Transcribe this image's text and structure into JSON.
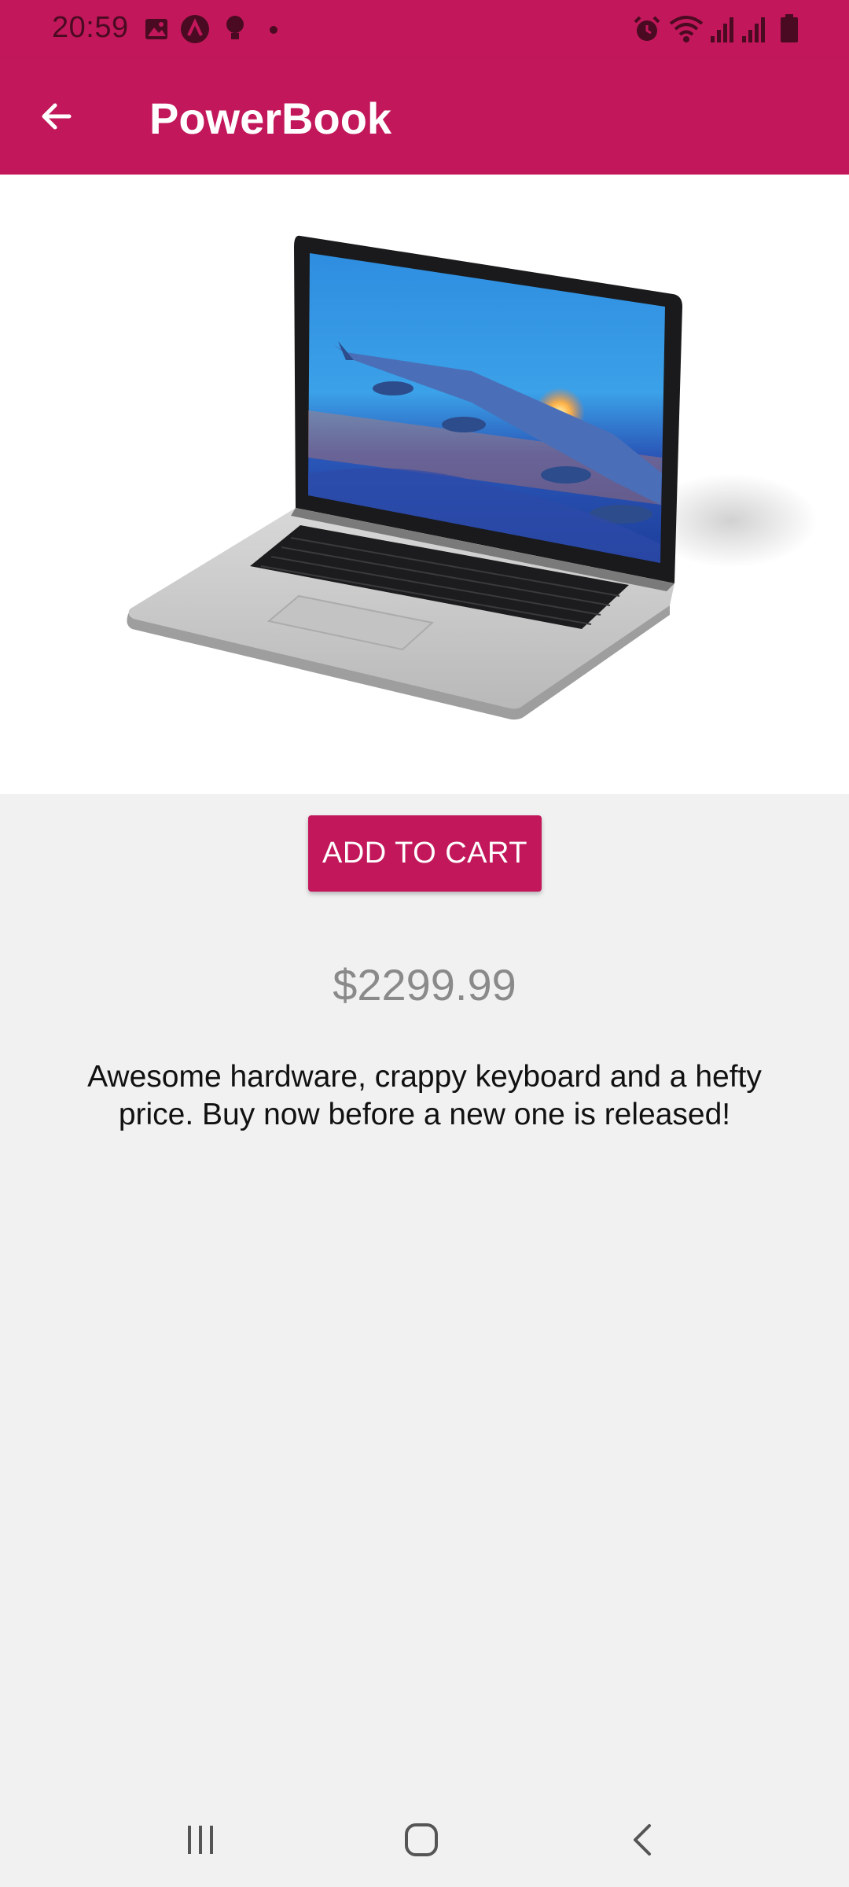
{
  "status_bar": {
    "time": "20:59"
  },
  "app_bar": {
    "title": "PowerBook",
    "back_icon": "arrow-left-icon"
  },
  "product": {
    "image_alt": "laptop-image",
    "add_to_cart_label": "ADD TO CART",
    "price": "$2299.99",
    "description": "Awesome hardware, crappy keyboard and a hefty price. Buy now before a new one is released!"
  },
  "nav_bar": {
    "recent_icon": "recent-apps-icon",
    "home_icon": "home-icon",
    "back_icon": "back-chevron-icon"
  },
  "colors": {
    "accent": "#c2185b",
    "background": "#f1f1f1",
    "price_text": "#8a8a8a"
  }
}
